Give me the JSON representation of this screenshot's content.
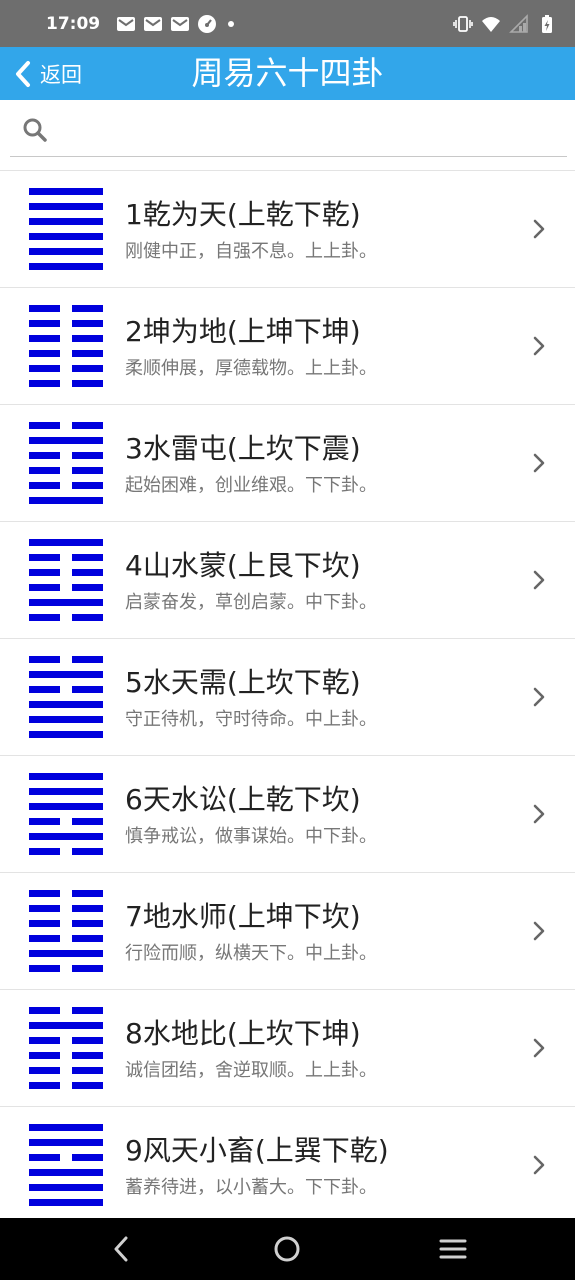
{
  "status_bar": {
    "time": "17:09",
    "icons": [
      "gmail-icon",
      "gmail-icon",
      "gmail-icon",
      "speedometer-icon",
      "dot-icon",
      "vibrate-icon",
      "wifi-icon",
      "signal-icon",
      "battery-charging-icon"
    ]
  },
  "header": {
    "back_label": "返回",
    "title": "周易六十四卦"
  },
  "search": {
    "placeholder": "",
    "value": ""
  },
  "colors": {
    "app_bar": "#32a6ea",
    "status_bar": "#6e6e6e",
    "hexagram_line": "#0000dd"
  },
  "items": [
    {
      "title": "1乾为天(上乾下乾)",
      "desc": "刚健中正，自强不息。上上卦。",
      "lines": [
        1,
        1,
        1,
        1,
        1,
        1
      ]
    },
    {
      "title": "2坤为地(上坤下坤)",
      "desc": "柔顺伸展，厚德载物。上上卦。",
      "lines": [
        0,
        0,
        0,
        0,
        0,
        0
      ]
    },
    {
      "title": "3水雷屯(上坎下震)",
      "desc": "起始困难，创业维艰。下下卦。",
      "lines": [
        0,
        1,
        0,
        0,
        0,
        1
      ]
    },
    {
      "title": "4山水蒙(上艮下坎)",
      "desc": "启蒙奋发，草创启蒙。中下卦。",
      "lines": [
        1,
        0,
        0,
        0,
        1,
        0
      ]
    },
    {
      "title": "5水天需(上坎下乾)",
      "desc": "守正待机，守时待命。中上卦。",
      "lines": [
        0,
        1,
        0,
        1,
        1,
        1
      ]
    },
    {
      "title": "6天水讼(上乾下坎)",
      "desc": "慎争戒讼，做事谋始。中下卦。",
      "lines": [
        1,
        1,
        1,
        0,
        1,
        0
      ]
    },
    {
      "title": "7地水师(上坤下坎)",
      "desc": "行险而顺，纵横天下。中上卦。",
      "lines": [
        0,
        0,
        0,
        0,
        1,
        0
      ]
    },
    {
      "title": "8水地比(上坎下坤)",
      "desc": "诚信团结，舍逆取顺。上上卦。",
      "lines": [
        0,
        1,
        0,
        0,
        0,
        0
      ]
    },
    {
      "title": "9风天小畜(上巽下乾)",
      "desc": "蓄养待进，以小蓄大。下下卦。",
      "lines": [
        1,
        1,
        0,
        1,
        1,
        1
      ]
    }
  ],
  "nav": {
    "buttons": [
      "back-icon",
      "home-icon",
      "menu-icon"
    ]
  }
}
